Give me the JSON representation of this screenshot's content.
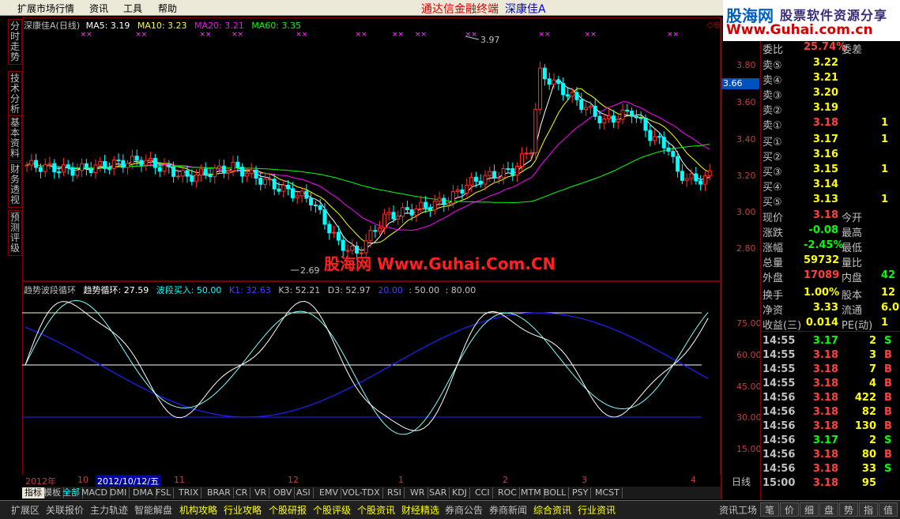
{
  "menu": {
    "items": [
      "扩展市场行情",
      "资讯",
      "工具",
      "帮助"
    ],
    "app_title": "通达信金融终端",
    "stock_title": "深康佳A"
  },
  "logo": {
    "brand_cn": "股海网",
    "slogan": "股票软件资源分享",
    "url": "Www.Guhai.com.cn"
  },
  "left_tabs": [
    "分时走势",
    "技术分析",
    "基本资料",
    "财务透视",
    "预测评级"
  ],
  "chart": {
    "stock_label": "深康佳A(日线)",
    "ma5": "MA5: 3.19",
    "ma10": "MA10: 3.23",
    "ma20": "MA20: 3.21",
    "ma60": "MA60: 3.35",
    "high_label": "3.97",
    "low_label": "2.69",
    "current_price_tag": "3.66",
    "watermark": "股海网 Www.Guhai.Com.CN",
    "price_axis": [
      "3.80",
      "3.60",
      "3.40",
      "3.20",
      "3.00",
      "2.80"
    ],
    "colors": {
      "ma5": "#ffffff",
      "ma10": "#ffff00",
      "ma20": "#ff00ff",
      "ma60": "#00ff00",
      "up": "#ff3030",
      "down": "#00ffff"
    }
  },
  "indicator": {
    "name": "趋势波段循环",
    "trend": "趋势循环: 27.59",
    "wave_buy": "波段买入: 50.00",
    "k1": "K1: 32.63",
    "k3": "K3: 52.21",
    "d3": "D3: 52.97",
    "v20": "20.00",
    "v50": ": 50.00",
    "v80": ": 80.00",
    "axis": [
      "75.00",
      "60.00",
      "45.00",
      "30.00",
      "15.00"
    ]
  },
  "date_axis": {
    "year": "2012年",
    "m10": "10",
    "selected": "2012/10/12/五",
    "m11": "11",
    "m12": "12",
    "m1": "1",
    "m2": "2",
    "m3": "3",
    "m4": "4",
    "period_label": "日线"
  },
  "indicator_tabs": [
    "指标",
    "模板",
    "全部",
    "MACD",
    "DMI",
    "DMA",
    "FSL",
    "TRIX",
    "BRAR",
    "CR",
    "VR",
    "OBV",
    "ASI",
    "EMV",
    "VOL-TDX",
    "RSI",
    "WR",
    "SAR",
    "KDJ",
    "CCI",
    "ROC",
    "MTM",
    "BOLL",
    "PSY",
    "MCST"
  ],
  "quote": {
    "weibi_label": "委比",
    "weibi_val": "25.74%",
    "weicha_label": "委差",
    "asks": [
      {
        "label": "卖⑤",
        "price": "3.22"
      },
      {
        "label": "卖④",
        "price": "3.21"
      },
      {
        "label": "卖③",
        "price": "3.20"
      },
      {
        "label": "卖②",
        "price": "3.19"
      },
      {
        "label": "卖①",
        "price": "3.18",
        "vol": "1"
      }
    ],
    "bids": [
      {
        "label": "买①",
        "price": "3.17",
        "vol": "1"
      },
      {
        "label": "买②",
        "price": "3.16"
      },
      {
        "label": "买③",
        "price": "3.15",
        "vol": "1"
      },
      {
        "label": "买④",
        "price": "3.14"
      },
      {
        "label": "买⑤",
        "price": "3.13",
        "vol": "1"
      }
    ],
    "stats": [
      {
        "l1": "现价",
        "v1": "3.18",
        "l2": "今开",
        "c": "#ff4040"
      },
      {
        "l1": "涨跌",
        "v1": "-0.08",
        "l2": "最高",
        "c": "#00ff00"
      },
      {
        "l1": "涨幅",
        "v1": "-2.45%",
        "l2": "最低",
        "c": "#00ff00"
      },
      {
        "l1": "总量",
        "v1": "59732",
        "l2": "量比",
        "c": "#ffff00"
      },
      {
        "l1": "外盘",
        "v1": "17089",
        "l2": "内盘",
        "v2": "42",
        "c": "#ff4040"
      }
    ],
    "stats2": [
      {
        "l1": "换手",
        "v1": "1.00%",
        "l2": "股本",
        "v2": "12"
      },
      {
        "l1": "净资",
        "v1": "3.33",
        "l2": "流通",
        "v2": "6.0"
      },
      {
        "l1": "收益(三)",
        "v1": "0.014",
        "l2": "PE(动)",
        "v2": "1"
      }
    ],
    "ticks": [
      {
        "t": "14:55",
        "p": "3.17",
        "v": "2",
        "d": "S"
      },
      {
        "t": "14:55",
        "p": "3.18",
        "v": "3",
        "d": "B"
      },
      {
        "t": "14:55",
        "p": "3.18",
        "v": "7",
        "d": "B"
      },
      {
        "t": "14:55",
        "p": "3.18",
        "v": "4",
        "d": "B"
      },
      {
        "t": "14:56",
        "p": "3.18",
        "v": "422",
        "d": "B"
      },
      {
        "t": "14:56",
        "p": "3.18",
        "v": "82",
        "d": "B"
      },
      {
        "t": "14:56",
        "p": "3.18",
        "v": "130",
        "d": "B"
      },
      {
        "t": "14:56",
        "p": "3.17",
        "v": "2",
        "d": "S"
      },
      {
        "t": "14:56",
        "p": "3.18",
        "v": "80",
        "d": "B"
      },
      {
        "t": "14:56",
        "p": "3.18",
        "v": "33",
        "d": "S"
      },
      {
        "t": "15:00",
        "p": "3.18",
        "v": "95",
        "d": ""
      }
    ]
  },
  "bottom_bar": {
    "items": [
      "扩展区",
      "关联报价",
      "主力轨迹",
      "智能解盘",
      "机构攻略",
      "行业攻略",
      "个股研报",
      "个股评级",
      "个股资讯",
      "财经精选",
      "券商公告",
      "券商新闻",
      "综合资讯",
      "行业资讯"
    ],
    "right": [
      "资讯工场",
      "笔",
      "价",
      "细",
      "盘",
      "势",
      "指",
      "值"
    ]
  }
}
